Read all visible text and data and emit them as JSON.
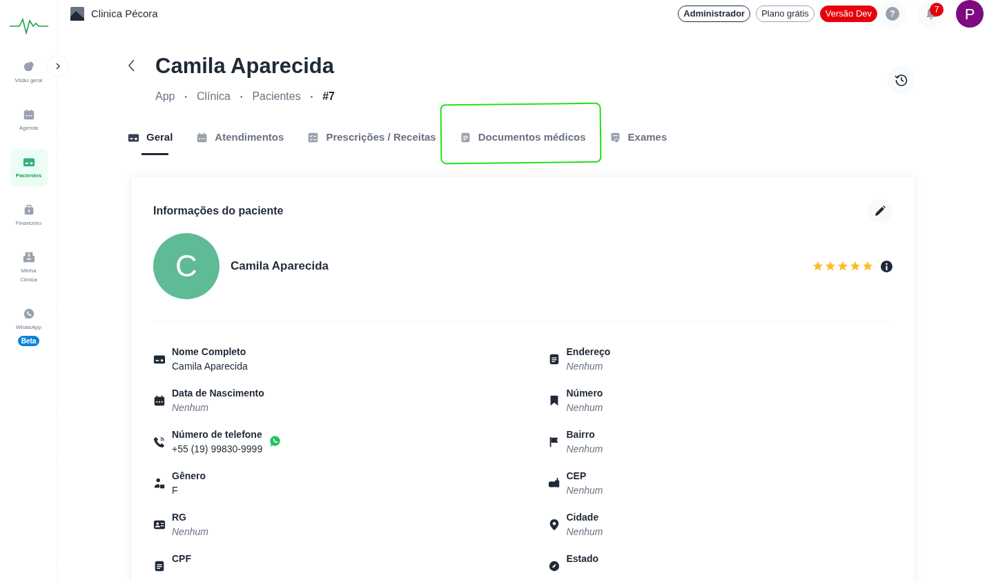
{
  "clinic": {
    "name": "Clinica Pécora"
  },
  "header": {
    "badges": [
      {
        "kind": "outline-bold",
        "label": "Administrador"
      },
      {
        "kind": "outline",
        "label": "Plano grátis"
      },
      {
        "kind": "danger",
        "label": "Versão Dev"
      }
    ],
    "help": "?",
    "notifications": "7",
    "avatar": "P"
  },
  "sidebar": {
    "items": [
      {
        "label": "Visão geral",
        "selected": false
      },
      {
        "label": "Agenda",
        "selected": false
      },
      {
        "label": "Pacientes",
        "selected": true
      },
      {
        "label": "Financeiro",
        "selected": false
      },
      {
        "label": "Minha Clínica",
        "selected": false
      },
      {
        "label": "WhatsApp",
        "selected": false,
        "badge": "Beta"
      }
    ]
  },
  "page": {
    "title": "Camila Aparecida",
    "breadcrumb": [
      {
        "label": "App",
        "separator": "•"
      },
      {
        "label": "Clínica",
        "separator": "•"
      },
      {
        "label": "Pacientes",
        "separator": "•"
      }
    ],
    "id": "#7"
  },
  "tabs": [
    {
      "label": "Geral",
      "selected": true
    },
    {
      "label": "Atendimentos",
      "selected": false
    },
    {
      "label": "Prescrições / Receitas",
      "selected": false
    },
    {
      "label": "Documentos médicos",
      "selected": false,
      "highlighted": true
    },
    {
      "label": "Exames",
      "selected": false
    }
  ],
  "patient": {
    "section_title": "Informações do paciente",
    "initial": "C",
    "name": "Camila Aparecida",
    "stars": 5,
    "left_fields": [
      {
        "label": "Nome Completo",
        "value": "Camila Aparecida",
        "empty": false
      },
      {
        "label": "Data de Nascimento",
        "value": "Nenhum",
        "empty": true
      },
      {
        "label": "Número de telefone",
        "value": "+55 (19) 99830-9999",
        "empty": false,
        "whatsapp": true
      },
      {
        "label": "Gênero",
        "value": "F",
        "empty": false
      },
      {
        "label": "RG",
        "value": "Nenhum",
        "empty": true
      },
      {
        "label": "CPF"
      }
    ],
    "right_fields": [
      {
        "label": "Endereço",
        "value": "Nenhum",
        "empty": true
      },
      {
        "label": "Número",
        "value": "Nenhum",
        "empty": true
      },
      {
        "label": "Bairro",
        "value": "Nenhum",
        "empty": true
      },
      {
        "label": "CEP",
        "value": "Nenhum",
        "empty": true
      },
      {
        "label": "Cidade",
        "value": "Nenhum",
        "empty": true
      },
      {
        "label": "Estado"
      }
    ]
  }
}
